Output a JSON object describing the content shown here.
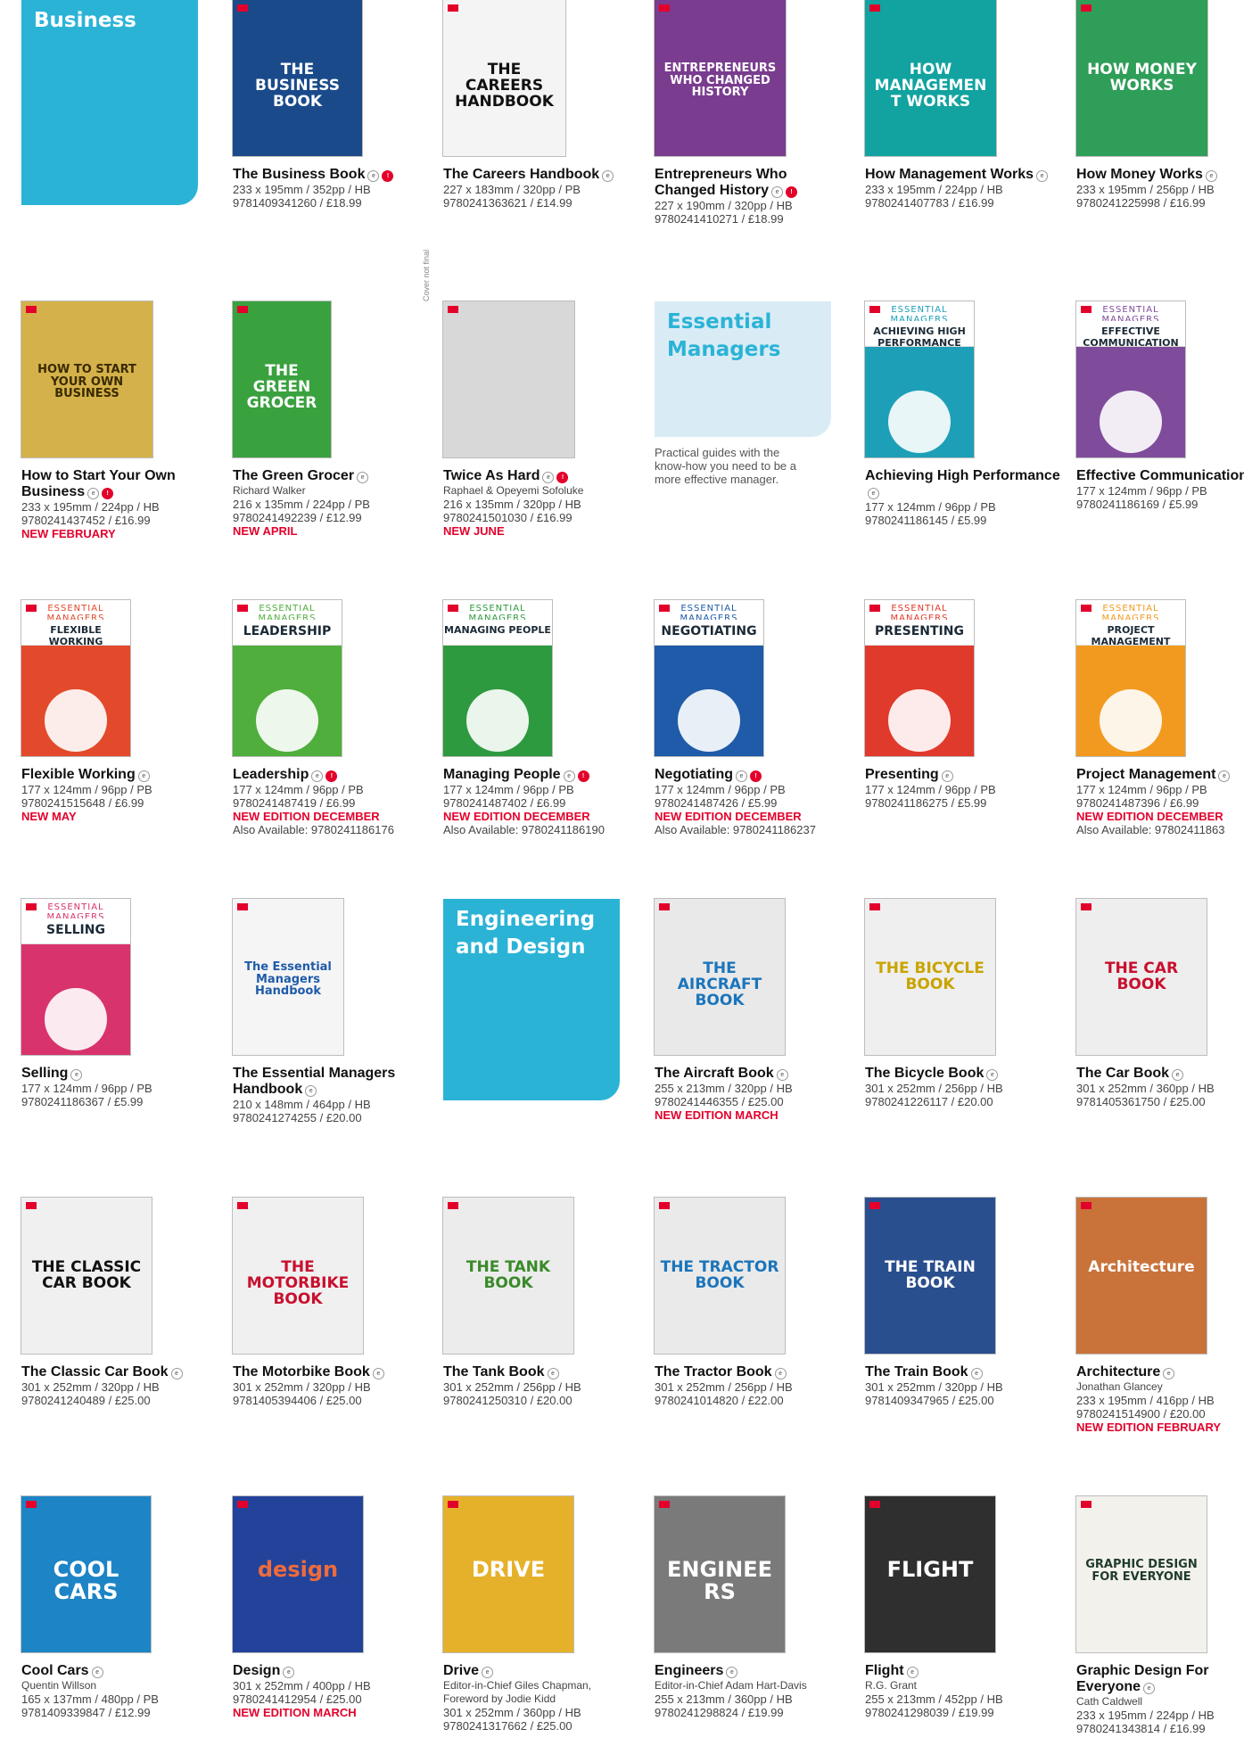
{
  "sections": {
    "business": {
      "label": "Business",
      "color": "#2bb3d6"
    },
    "essential_managers": {
      "label": "Essential Managers",
      "description": "Practical guides with the know-how you need to be a more effective manager."
    },
    "engineering": {
      "label": "Engineering and Design",
      "color": "#2bb3d6"
    }
  },
  "cover_note": "Cover not final",
  "books": [
    {
      "id": "business-book",
      "title": "The Business Book",
      "author": "",
      "specs": "233 x 195mm / 352pp / HB",
      "isbn_price": "9781409341260 / £18.99",
      "note": "",
      "also": "",
      "cover_text": "THE BUSINESS BOOK",
      "cover_color": "#1a4a8a",
      "text_color": "#ffffff"
    },
    {
      "id": "careers-handbook",
      "title": "The Careers Handbook",
      "author": "",
      "specs": "227 x 183mm / 320pp / PB",
      "isbn_price": "9780241363621 / £14.99",
      "note": "",
      "also": "",
      "cover_text": "THE CAREERS HANDBOOK",
      "cover_color": "#f4f4f4",
      "text_color": "#111111"
    },
    {
      "id": "entrepreneurs",
      "title": "Entrepreneurs Who Changed History",
      "author": "",
      "specs": "227 x 190mm / 320pp / HB",
      "isbn_price": "9780241410271 / £18.99",
      "note": "",
      "also": "",
      "cover_text": "ENTREPRENEURS WHO CHANGED HISTORY",
      "cover_color": "#7a3c8f",
      "text_color": "#ffffff"
    },
    {
      "id": "how-management-works",
      "title": "How Management Works",
      "author": "",
      "specs": "233 x 195mm / 224pp / HB",
      "isbn_price": "9780241407783 / £16.99",
      "note": "",
      "also": "",
      "cover_text": "HOW MANAGEMENT WORKS",
      "cover_color": "#12a3a0",
      "text_color": "#ffffff"
    },
    {
      "id": "how-money-works",
      "title": "How Money Works",
      "author": "",
      "specs": "233 x 195mm / 256pp / HB",
      "isbn_price": "9780241225998 / £16.99",
      "note": "",
      "also": "",
      "cover_text": "HOW MONEY WORKS",
      "cover_color": "#2f9e58",
      "text_color": "#ffffff"
    },
    {
      "id": "start-business",
      "title": "How to Start Your Own Business",
      "author": "",
      "specs": "233 x 195mm / 224pp / HB",
      "isbn_price": "9780241437452 / £16.99",
      "note": "NEW FEBRUARY",
      "also": "",
      "cover_text": "HOW TO START YOUR OWN BUSINESS",
      "cover_color": "#d4b14a",
      "text_color": "#3a2a00"
    },
    {
      "id": "green-grocer",
      "title": "The Green Grocer",
      "author": "Richard Walker",
      "specs": "216 x 135mm / 224pp / PB",
      "isbn_price": "9780241492239 / £12.99",
      "note": "NEW APRIL",
      "also": "",
      "cover_text": "THE GREEN GROCER",
      "cover_color": "#3aa13f",
      "text_color": "#ffffff"
    },
    {
      "id": "twice-as-hard",
      "title": "Twice As Hard",
      "author": "Raphael & Opeyemi Sofoluke",
      "specs": "216 x 135mm / 320pp / HB",
      "isbn_price": "9780241501030 / £16.99",
      "note": "NEW JUNE",
      "also": "",
      "cover_text": "",
      "cover_color": "#d8d8d8",
      "text_color": "#111111"
    },
    {
      "id": "achieving-high-performance",
      "title": "Achieving High Performance",
      "author": "",
      "specs": "177 x 124mm / 96pp / PB",
      "isbn_price": "9780241186145 / £5.99",
      "note": "",
      "also": "",
      "cover_text": "ACHIEVING HIGH PERFORMANCE",
      "cover_color": "#1d9fb8",
      "text_color": "#ffffff"
    },
    {
      "id": "effective-communication",
      "title": "Effective Communication",
      "author": "",
      "specs": "177 x 124mm / 96pp / PB",
      "isbn_price": "9780241186169 / £5.99",
      "note": "",
      "also": "",
      "cover_text": "EFFECTIVE COMMUNICATION",
      "cover_color": "#7f4c9c",
      "text_color": "#ffffff"
    },
    {
      "id": "flexible-working",
      "title": "Flexible Working",
      "author": "",
      "specs": "177 x 124mm / 96pp / PB",
      "isbn_price": "9780241515648 / £6.99",
      "note": "NEW MAY",
      "also": "",
      "cover_text": "FLEXIBLE WORKING",
      "cover_color": "#e24a2b",
      "text_color": "#ffffff"
    },
    {
      "id": "leadership",
      "title": "Leadership",
      "author": "",
      "specs": "177 x 124mm / 96pp / PB",
      "isbn_price": "9780241487419 / £6.99",
      "note": "NEW EDITION DECEMBER",
      "also": "Also Available: 9780241186176",
      "cover_text": "LEADERSHIP",
      "cover_color": "#4fae3c",
      "text_color": "#ffffff"
    },
    {
      "id": "managing-people",
      "title": "Managing People",
      "author": "",
      "specs": "177 x 124mm / 96pp / PB",
      "isbn_price": "9780241487402 / £6.99",
      "note": "NEW EDITION DECEMBER",
      "also": "Also Available: 9780241186190",
      "cover_text": "MANAGING PEOPLE",
      "cover_color": "#2e9a3f",
      "text_color": "#ffffff"
    },
    {
      "id": "negotiating",
      "title": "Negotiating",
      "author": "",
      "specs": "177 x 124mm / 96pp / PB",
      "isbn_price": "9780241487426 / £5.99",
      "note": "NEW EDITION DECEMBER",
      "also": "Also Available: 9780241186237",
      "cover_text": "NEGOTIATING",
      "cover_color": "#1f5ba8",
      "text_color": "#ffffff"
    },
    {
      "id": "presenting",
      "title": "Presenting",
      "author": "",
      "specs": "177 x 124mm / 96pp / PB",
      "isbn_price": "9780241186275 / £5.99",
      "note": "",
      "also": "",
      "cover_text": "PRESENTING",
      "cover_color": "#e03a2c",
      "text_color": "#ffffff"
    },
    {
      "id": "project-management",
      "title": "Project Management",
      "author": "",
      "specs": "177 x 124mm / 96pp / PB",
      "isbn_price": "9780241487396 / £6.99",
      "note": "NEW EDITION DECEMBER",
      "also": "Also Available: 97802411863",
      "cover_text": "PROJECT MANAGEMENT",
      "cover_color": "#f29a1f",
      "text_color": "#ffffff"
    },
    {
      "id": "selling",
      "title": "Selling",
      "author": "",
      "specs": "177 x 124mm / 96pp / PB",
      "isbn_price": "9780241186367 / £5.99",
      "note": "",
      "also": "",
      "cover_text": "SELLING",
      "cover_color": "#d8336c",
      "text_color": "#ffffff"
    },
    {
      "id": "essential-managers-handbook",
      "title": "The Essential Managers Handbook",
      "author": "",
      "specs": "210 x 148mm / 464pp / HB",
      "isbn_price": "9780241274255 / £20.00",
      "note": "",
      "also": "",
      "cover_text": "The Essential Managers Handbook",
      "cover_color": "#f5f5f5",
      "text_color": "#1f5ba8"
    },
    {
      "id": "aircraft-book",
      "title": "The Aircraft Book",
      "author": "",
      "specs": "255 x 213mm / 320pp / HB",
      "isbn_price": "9780241446355 / £25.00",
      "note": "NEW EDITION MARCH",
      "also": "",
      "cover_text": "THE AIRCRAFT BOOK",
      "cover_color": "#e9e9e9",
      "text_color": "#1b75bb"
    },
    {
      "id": "bicycle-book",
      "title": "The Bicycle Book",
      "author": "",
      "specs": "301 x 252mm / 256pp / HB",
      "isbn_price": "9780241226117 / £20.00",
      "note": "",
      "also": "",
      "cover_text": "THE BICYCLE BOOK",
      "cover_color": "#efefef",
      "text_color": "#c9a400"
    },
    {
      "id": "car-book",
      "title": "The Car Book",
      "author": "",
      "specs": "301 x 252mm / 360pp / HB",
      "isbn_price": "9781405361750 / £25.00",
      "note": "",
      "also": "",
      "cover_text": "THE CAR BOOK",
      "cover_color": "#eeeeee",
      "text_color": "#c8102e"
    },
    {
      "id": "classic-car-book",
      "title": "The Classic Car Book",
      "author": "",
      "specs": "301 x 252mm / 320pp / HB",
      "isbn_price": "9780241240489 / £25.00",
      "note": "",
      "also": "",
      "cover_text": "THE CLASSIC CAR BOOK",
      "cover_color": "#f0f0f0",
      "text_color": "#111111"
    },
    {
      "id": "motorbike-book",
      "title": "The Motorbike Book",
      "author": "",
      "specs": "301 x 252mm / 320pp / HB",
      "isbn_price": "9781405394406 / £25.00",
      "note": "",
      "also": "",
      "cover_text": "THE MOTORBIKE BOOK",
      "cover_color": "#f0f0f0",
      "text_color": "#c8102e"
    },
    {
      "id": "tank-book",
      "title": "The Tank Book",
      "author": "",
      "specs": "301 x 252mm / 256pp / HB",
      "isbn_price": "9780241250310 / £20.00",
      "note": "",
      "also": "",
      "cover_text": "THE TANK BOOK",
      "cover_color": "#ececec",
      "text_color": "#3a8a2a"
    },
    {
      "id": "tractor-book",
      "title": "The Tractor Book",
      "author": "",
      "specs": "301 x 252mm / 256pp / HB",
      "isbn_price": "9780241014820 / £22.00",
      "note": "",
      "also": "",
      "cover_text": "THE TRACTOR BOOK",
      "cover_color": "#eaeaea",
      "text_color": "#1b75bb"
    },
    {
      "id": "train-book",
      "title": "The Train Book",
      "author": "",
      "specs": "301 x 252mm / 320pp / HB",
      "isbn_price": "9781409347965 / £25.00",
      "note": "",
      "also": "",
      "cover_text": "THE TRAIN BOOK",
      "cover_color": "#2a4f8f",
      "text_color": "#ffffff"
    },
    {
      "id": "architecture",
      "title": "Architecture",
      "author": "Jonathan Glancey",
      "specs": "233 x 195mm / 416pp / HB",
      "isbn_price": "9780241514900 / £20.00",
      "note": "NEW EDITION FEBRUARY",
      "also": "",
      "cover_text": "Architecture",
      "cover_color": "#c9733b",
      "text_color": "#ffffff"
    },
    {
      "id": "cool-cars",
      "title": "Cool Cars",
      "author": "Quentin Willson",
      "specs": "165 x 137mm / 480pp / PB",
      "isbn_price": "9781409339847 / £12.99",
      "note": "",
      "also": "",
      "cover_text": "COOL CARS",
      "cover_color": "#1d84c6",
      "text_color": "#ffffff"
    },
    {
      "id": "design",
      "title": "Design",
      "author": "",
      "specs": "301 x 252mm / 400pp / HB",
      "isbn_price": "9780241412954 / £25.00",
      "note": "NEW EDITION MARCH",
      "also": "",
      "cover_text": "design",
      "cover_color": "#23439b",
      "text_color": "#ef6b3b"
    },
    {
      "id": "drive",
      "title": "Drive",
      "author": "Editor-in-Chief Giles Chapman, Foreword by Jodie Kidd",
      "specs": "301 x 252mm / 360pp / HB",
      "isbn_price": "9780241317662 / £25.00",
      "note": "",
      "also": "",
      "cover_text": "DRIVE",
      "cover_color": "#e6b12a",
      "text_color": "#ffffff"
    },
    {
      "id": "engineers",
      "title": "Engineers",
      "author": "Editor-in-Chief Adam Hart-Davis",
      "specs": "255 x 213mm / 360pp / HB",
      "isbn_price": "9780241298824 / £19.99",
      "note": "",
      "also": "",
      "cover_text": "ENGINEERS",
      "cover_color": "#7a7a7a",
      "text_color": "#ffffff"
    },
    {
      "id": "flight",
      "title": "Flight",
      "author": "R.G. Grant",
      "specs": "255 x 213mm / 452pp / HB",
      "isbn_price": "9780241298039 / £19.99",
      "note": "",
      "also": "",
      "cover_text": "FLIGHT",
      "cover_color": "#2f2f2f",
      "text_color": "#ffffff"
    },
    {
      "id": "graphic-design",
      "title": "Graphic Design For Everyone",
      "author": "Cath Caldwell",
      "specs": "233 x 195mm / 224pp / HB",
      "isbn_price": "9780241343814 / £16.99",
      "note": "",
      "also": "",
      "cover_text": "GRAPHIC DESIGN FOR EVERYONE",
      "cover_color": "#f3f1ec",
      "text_color": "#1f3b2a"
    }
  ]
}
